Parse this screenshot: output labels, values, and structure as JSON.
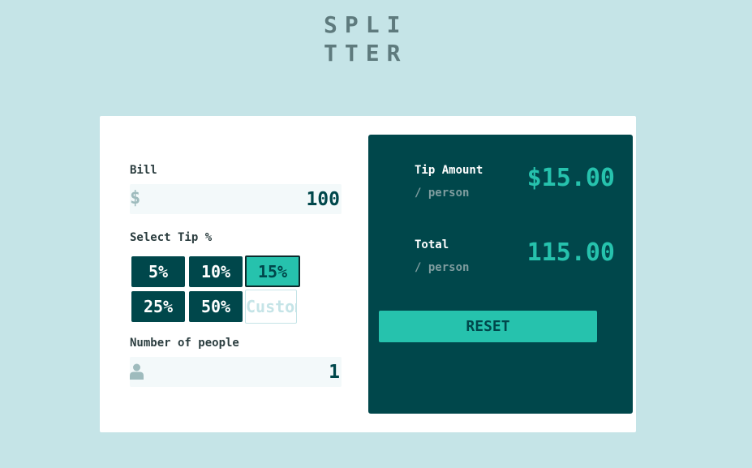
{
  "logo": {
    "line1": "SPLI",
    "line2": "TTER"
  },
  "bill": {
    "label": "Bill",
    "currency_symbol": "$",
    "value": "100"
  },
  "tip": {
    "label": "Select Tip %",
    "options": [
      "5%",
      "10%",
      "15%",
      "25%",
      "50%"
    ],
    "selected": "15%",
    "custom_placeholder": "Custom"
  },
  "people": {
    "label": "Number of people",
    "value": "1"
  },
  "results": {
    "tip_amount_label": "Tip Amount",
    "tip_amount_sub": "/ person",
    "tip_amount_value": "$15.00",
    "total_label": "Total",
    "total_sub": "/ person",
    "total_value": "115.00",
    "reset_label": "RESET"
  },
  "colors": {
    "background": "#c5e4e7",
    "dark_cyan": "#00474b",
    "accent": "#26c2ad",
    "field_bg": "#f3f9fa"
  }
}
